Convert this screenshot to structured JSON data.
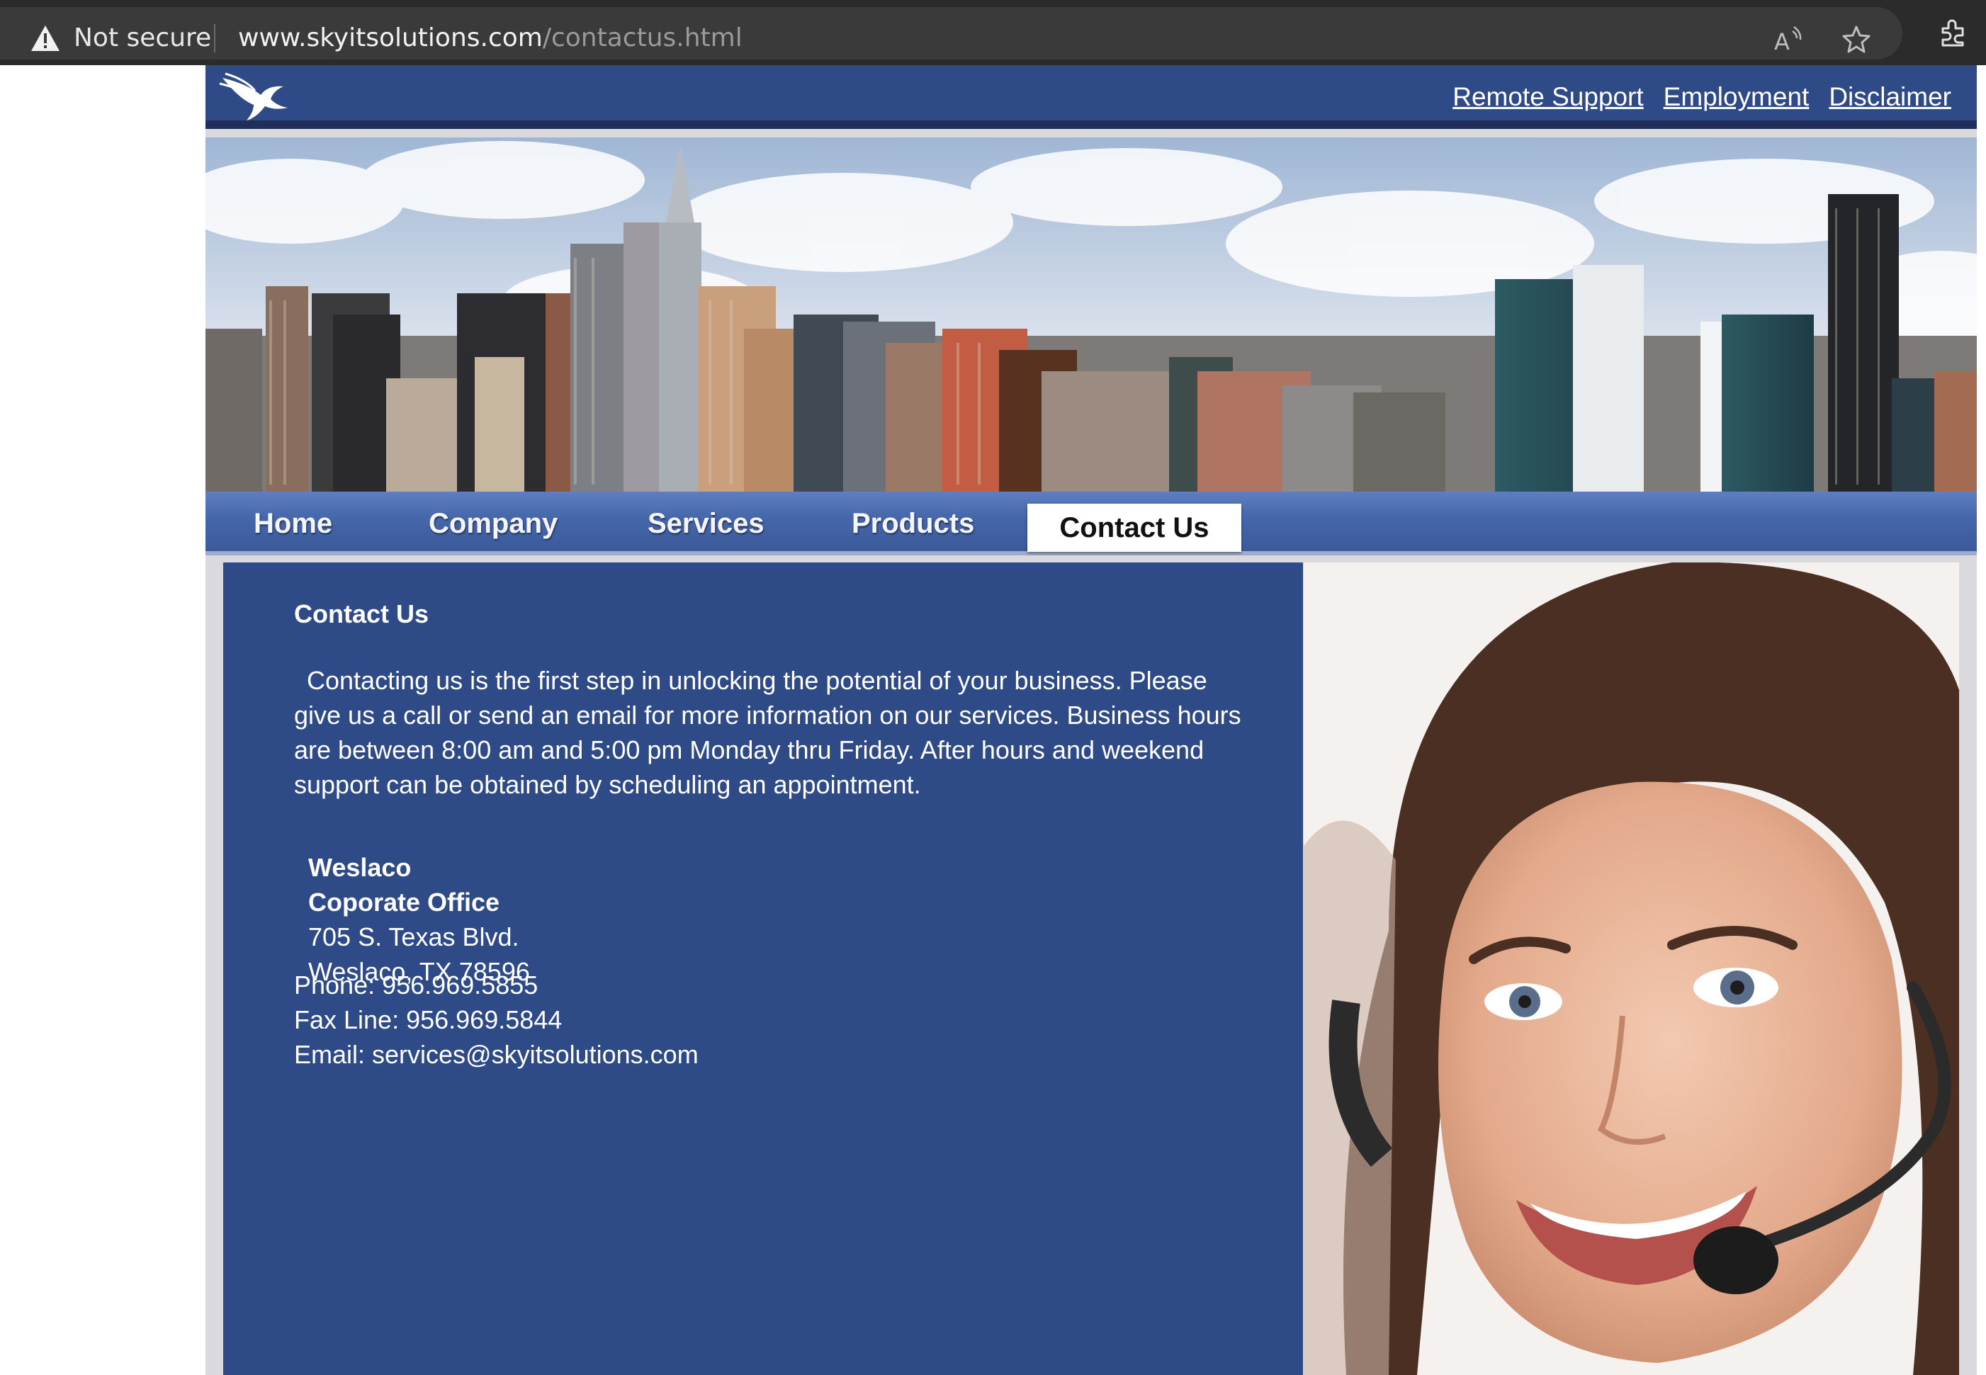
{
  "browser": {
    "security_label": "Not secure",
    "url_host": "www.skyitsolutions.com",
    "url_path": "/contactus.html"
  },
  "header": {
    "links": [
      "Remote Support",
      "Employment",
      "Disclaimer"
    ]
  },
  "nav": {
    "items": [
      "Home",
      "Company",
      "Services",
      "Products"
    ],
    "active": "Contact Us"
  },
  "content": {
    "title": "Contact Us",
    "paragraph": "Contacting us is the first step in unlocking the potential of your business. Please give us a call or send an email for more information on our services. Business hours are between 8:00 am and 5:00 pm Monday thru Friday. After hours and weekend support can be obtained by scheduling an appointment.",
    "office_city": "Weslaco",
    "office_name": "Coporate Office",
    "address_line1": "705 S. Texas Blvd.",
    "address_line2": "Weslaco, TX 78596",
    "phone": "Phone: 956.969.5855",
    "fax": "Fax Line: 956.969.5844",
    "email": "Email: services@skyitsolutions.com"
  },
  "colors": {
    "brand_blue": "#2e4b87",
    "nav_gradient_top": "#5f7fc2",
    "browser_bg": "#2b2b2b"
  }
}
